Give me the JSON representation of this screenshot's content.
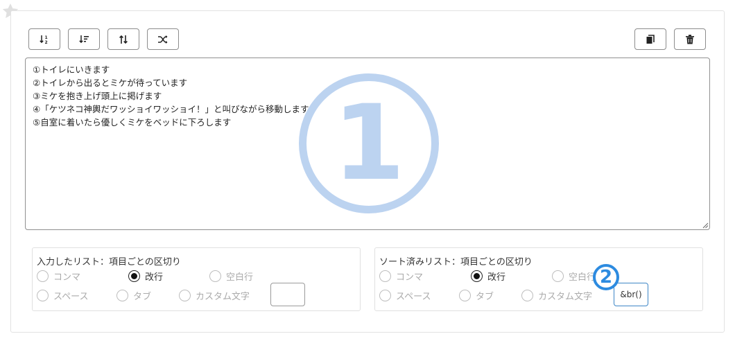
{
  "toolbar": {
    "left_buttons": [
      "sort-ascending-icon",
      "sort-descending-icon",
      "reverse-icon",
      "shuffle-icon"
    ],
    "right_buttons": [
      "copy-icon",
      "trash-icon"
    ]
  },
  "textarea": {
    "value": "①トイレにいきます\n②トイレから出るとミケが待っています\n③ミケを抱き上げ頭上に掲げます\n④「ケツネコ神輿だワッショイワッショイ！」と叫びながら移動します\n⑤自室に着いたら優しくミケをベッドに下ろします"
  },
  "overlays": {
    "one": "1",
    "two": "2"
  },
  "input_list": {
    "title": "入力したリスト：項目ごとの区切り",
    "options": [
      "コンマ",
      "改行",
      "空白行",
      "スペース",
      "タブ",
      "カスタム文字"
    ],
    "selected": "改行",
    "custom_value": ""
  },
  "sorted_list": {
    "title": "ソート済みリスト：項目ごとの区切り",
    "options": [
      "コンマ",
      "改行",
      "空白行",
      "スペース",
      "タブ",
      "カスタム文字"
    ],
    "selected": "改行",
    "custom_value": "&br()"
  },
  "colors": {
    "accent_blue": "#2d8be0",
    "overlay_light_blue": "#bcd3f0",
    "border_gray": "#8f8f8f"
  }
}
